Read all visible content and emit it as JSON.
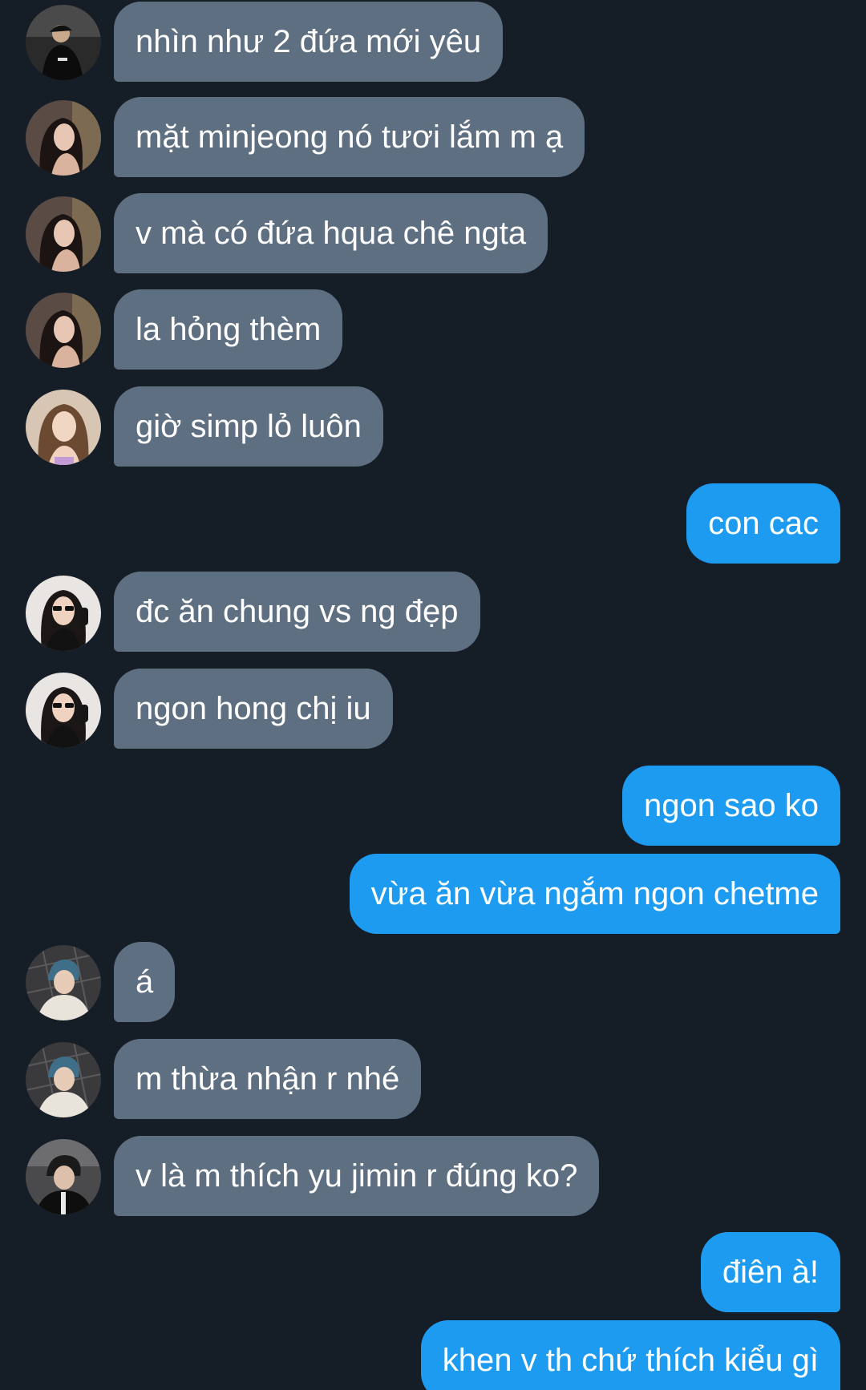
{
  "messages": [
    {
      "side": "incoming",
      "text": "nhìn như 2 đứa mới yêu",
      "avatar": "avatar-boy-cap"
    },
    {
      "side": "incoming",
      "text": "mặt minjeong nó tươi lắm m ạ",
      "avatar": "avatar-girl-dark-hair"
    },
    {
      "side": "incoming",
      "text": "v mà có đứa hqua chê ngta",
      "avatar": "avatar-girl-dark-hair"
    },
    {
      "side": "incoming",
      "text": "la hỏng thèm",
      "avatar": "avatar-girl-dark-hair"
    },
    {
      "side": "incoming",
      "text": "giờ simp lỏ luôn",
      "avatar": "avatar-girl-light"
    },
    {
      "side": "outgoing",
      "text": "con cac"
    },
    {
      "side": "incoming",
      "text": "đc ăn chung vs ng đẹp",
      "avatar": "avatar-girl-sunglasses"
    },
    {
      "side": "incoming",
      "text": "ngon hong chị iu",
      "avatar": "avatar-girl-sunglasses"
    },
    {
      "side": "outgoing",
      "text": "ngon sao ko"
    },
    {
      "side": "outgoing",
      "text": "vừa ăn vừa ngắm ngon chetme"
    },
    {
      "side": "incoming",
      "text": "á",
      "avatar": "avatar-boy-blue-hair"
    },
    {
      "side": "incoming",
      "text": "m thừa nhận r nhé",
      "avatar": "avatar-boy-blue-hair"
    },
    {
      "side": "incoming",
      "text": "v là m thích yu jimin r đúng ko?",
      "avatar": "avatar-boy-dark"
    },
    {
      "side": "outgoing",
      "text": "điên à!"
    },
    {
      "side": "outgoing",
      "text": "khen v th chứ thích kiểu gì"
    }
  ],
  "colors": {
    "background": "#151d27",
    "incoming_bubble": "#5f6f82",
    "outgoing_bubble": "#1d9bf0",
    "text": "#ffffff"
  }
}
